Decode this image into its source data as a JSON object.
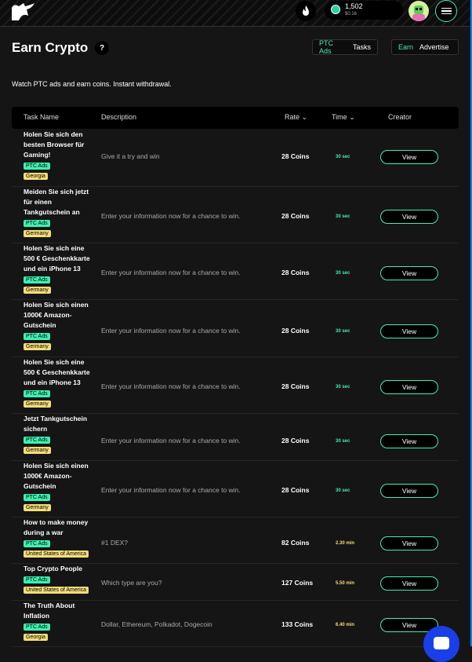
{
  "header": {
    "balance": "1,502",
    "balance_usd": "$0.16"
  },
  "page": {
    "title": "Earn Crypto",
    "help": "?",
    "subtitle": "Watch PTC ads and earn coins. Instant withdrawal."
  },
  "toggles": {
    "ptc_ads": "PTC Ads",
    "tasks": "Tasks",
    "earn": "Earn",
    "advertise": "Advertise"
  },
  "table": {
    "headers": [
      "Task Name",
      "Description",
      "Rate",
      "Time",
      "Creator"
    ],
    "rows": [
      {
        "name": "Holen Sie sich den besten Browser für Gaming!",
        "desc": "Give it a try and win",
        "rate": "28 Coins",
        "time": "30 sec",
        "tag": "PTC Ads",
        "geo": "Georgia",
        "action": "View"
      },
      {
        "name": "Meiden Sie sich jetzt für einen Tankgutschein an",
        "desc": "Enter your information now for a chance to win.",
        "rate": "28 Coins",
        "time": "30 sec",
        "tag": "PTC Ads",
        "geo": "Germany",
        "action": "View"
      },
      {
        "name": "Holen Sie sich eine 500 € Geschenkkarte und ein iPhone 13",
        "desc": "Enter your information now for a chance to win.",
        "rate": "28 Coins",
        "time": "30 sec",
        "tag": "PTC Ads",
        "geo": "Germany",
        "action": "View"
      },
      {
        "name": "Holen Sie sich einen 1000€ Amazon-Gutschein",
        "desc": "Enter your information now for a chance to win.",
        "rate": "28 Coins",
        "time": "30 sec",
        "tag": "PTC Ads",
        "geo": "Germany",
        "action": "View"
      },
      {
        "name": "Holen Sie sich eine 500 € Geschenkkarte und ein iPhone 13",
        "desc": "Enter your information now for a chance to win.",
        "rate": "28 Coins",
        "time": "30 sec",
        "tag": "PTC Ads",
        "geo": "Germany",
        "action": "View"
      },
      {
        "name": "Jetzt Tankgutschein sichern",
        "desc": "Enter your information now for a chance to win.",
        "rate": "28 Coins",
        "time": "30 sec",
        "tag": "PTC Ads",
        "geo": "Germany",
        "action": "View"
      },
      {
        "name": "Holen Sie sich einen 1000€ Amazon-Gutschein",
        "desc": "Enter your information now for a chance to win.",
        "rate": "28 Coins",
        "time": "30 sec",
        "tag": "PTC Ads",
        "geo": "Germany",
        "action": "View"
      },
      {
        "name": "How to make money during a war",
        "desc": "#1 DEX?",
        "rate": "82 Coins",
        "time": "2.30 min",
        "tag": "PTC Ads",
        "geo": "United States of America",
        "action": "View"
      },
      {
        "name": "Top Crypto People",
        "desc": "Which type are you?",
        "rate": "127 Coins",
        "time": "5.50 min",
        "tag": "PTC Ads",
        "geo": "United States of America",
        "action": "View"
      },
      {
        "name": "The Truth About Inflation",
        "desc": "Dollar, Ethereum, Polkadot, Dogecoin",
        "rate": "133 Coins",
        "time": "6.40 min",
        "tag": "PTC Ads",
        "geo": "Georgia",
        "action": "View"
      }
    ]
  }
}
